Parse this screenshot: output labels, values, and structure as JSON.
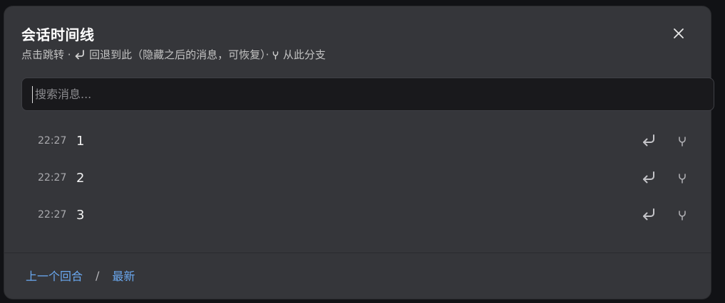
{
  "dialog": {
    "title": "会话时间线",
    "subtitle": {
      "jump": "点击跳转 · ",
      "revert": " 回退到此（隐藏之后的消息，可恢复）· ",
      "branch": " 从此分支"
    },
    "close_icon": "close-icon"
  },
  "search": {
    "placeholder": "搜索消息...",
    "value": ""
  },
  "timeline": {
    "items": [
      {
        "time": "22:27",
        "text": "1"
      },
      {
        "time": "22:27",
        "text": "2"
      },
      {
        "time": "22:27",
        "text": "3"
      }
    ],
    "revert_icon": "return-arrow-icon",
    "branch_icon": "fork-icon"
  },
  "footer": {
    "prev_round": "上一个回合",
    "separator": "/",
    "latest": "最新"
  },
  "colors": {
    "panel_bg": "#35363a",
    "page_bg": "#111215",
    "search_bg": "#19191c",
    "link": "#6aa8f0"
  }
}
